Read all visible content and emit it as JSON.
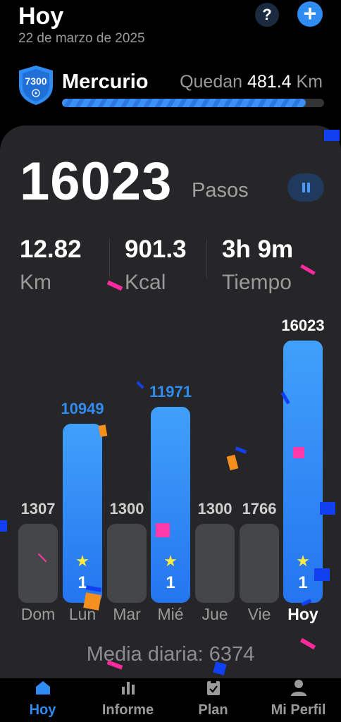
{
  "header": {
    "title": "Hoy",
    "date": "22 de marzo de 2025",
    "help_label": "?",
    "add_label": "+"
  },
  "goal": {
    "badge_number": "7300",
    "name": "Mercurio",
    "remaining_prefix": "Quedan",
    "remaining_value": "481.4",
    "remaining_unit": "Km",
    "progress": 0.93
  },
  "steps": {
    "count": "16023",
    "unit": "Pasos"
  },
  "stats": [
    {
      "value": "12.82",
      "label": "Km"
    },
    {
      "value": "901.3",
      "label": "Kcal"
    },
    {
      "value": "3h 9m",
      "label": "Tiempo"
    }
  ],
  "chart_data": {
    "type": "bar",
    "categories": [
      "Dom",
      "Lun",
      "Mar",
      "Mié",
      "Jue",
      "Vie",
      "Hoy"
    ],
    "values": [
      1307,
      10949,
      1300,
      11971,
      1300,
      1766,
      16023
    ],
    "goal_reached": [
      false,
      true,
      false,
      true,
      false,
      false,
      true
    ],
    "goal_counts": [
      "",
      "1",
      "",
      "1",
      "",
      "",
      "1"
    ]
  },
  "average": "Media diaria: 6374",
  "tabs": [
    {
      "label": "Hoy",
      "icon": "home-icon",
      "active": true
    },
    {
      "label": "Informe",
      "icon": "bar-chart-icon",
      "active": false
    },
    {
      "label": "Plan",
      "icon": "clipboard-icon",
      "active": false
    },
    {
      "label": "Mi Perfil",
      "icon": "person-icon",
      "active": false
    }
  ],
  "colors": {
    "accent": "#2f8cf3",
    "background": "#000000",
    "card": "#262628",
    "star": "#ffeb3b"
  }
}
